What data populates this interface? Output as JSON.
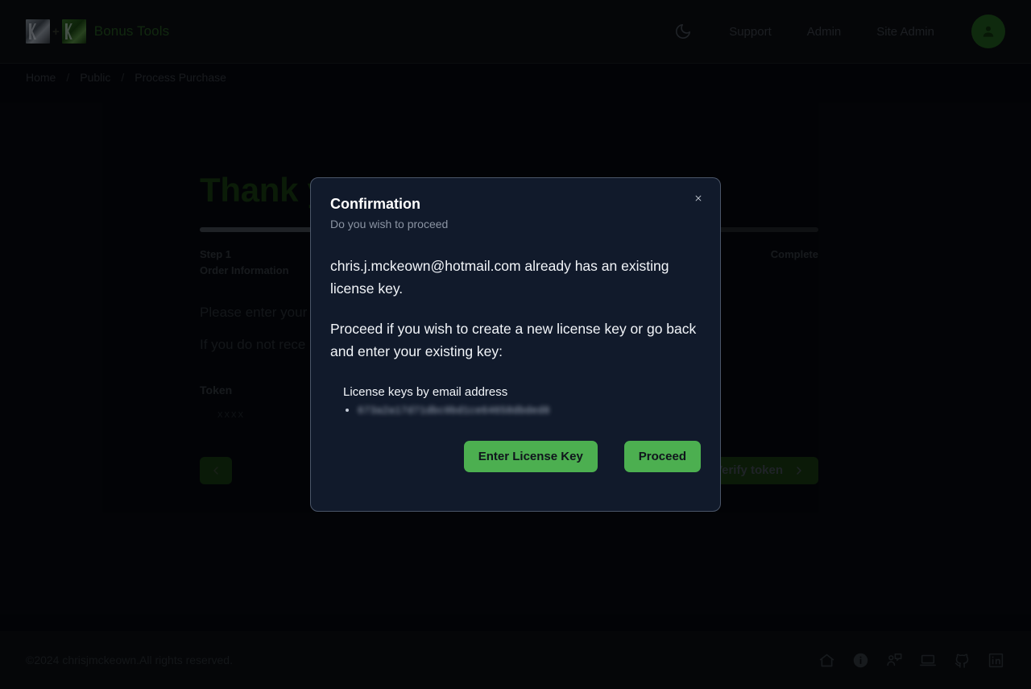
{
  "header": {
    "brand_name": "Bonus Tools",
    "logo_plus": "+",
    "theme_toggle_icon": "moon-icon",
    "avatar_icon": "user-icon",
    "nav": [
      {
        "label": "Support"
      },
      {
        "label": "Admin"
      },
      {
        "label": "Site Admin"
      }
    ]
  },
  "breadcrumb": {
    "separator": "/",
    "items": [
      {
        "label": "Home"
      },
      {
        "label": "Public"
      },
      {
        "label": "Process Purchase"
      }
    ]
  },
  "main": {
    "page_title": "Thank you",
    "progress_percent": 31,
    "steps": [
      {
        "number": "Step 1",
        "label": "Order Information"
      },
      {
        "number": "",
        "label": "Complete"
      }
    ],
    "paragraph_1": "Please enter your",
    "paragraph_2": "If you do not rece",
    "token_label": "Token",
    "token_value": "xxxx",
    "back_button": {
      "icon": "chevron-left-icon",
      "label": ""
    },
    "verify_button": {
      "label": "Verify token",
      "icon": "chevron-right-icon"
    }
  },
  "modal": {
    "title": "Confirmation",
    "subtitle": "Do you wish to proceed",
    "close_icon": "close-icon",
    "paragraph_1": "chris.j.mckeown@hotmail.com already has an existing license key.",
    "paragraph_2": "Proceed if you wish to create a new license key or go back and enter your existing key:",
    "keys_heading": "License keys by email address",
    "keys": [
      "673a2a17d71dbc0bd1ce64658dbded8"
    ],
    "buttons": {
      "enter_license_key": "Enter License Key",
      "proceed": "Proceed"
    }
  },
  "footer": {
    "copyright": "©2024 chrisjmckeown.All rights reserved.",
    "icons": [
      {
        "name": "home-icon"
      },
      {
        "name": "info-icon"
      },
      {
        "name": "support-chat-icon"
      },
      {
        "name": "laptop-icon"
      },
      {
        "name": "github-icon"
      },
      {
        "name": "linkedin-icon"
      }
    ]
  },
  "colors": {
    "accent_green": "#4caf50",
    "brand_green": "#1f4a1c",
    "modal_bg": "#111a2b",
    "page_bg": "#05070c"
  }
}
